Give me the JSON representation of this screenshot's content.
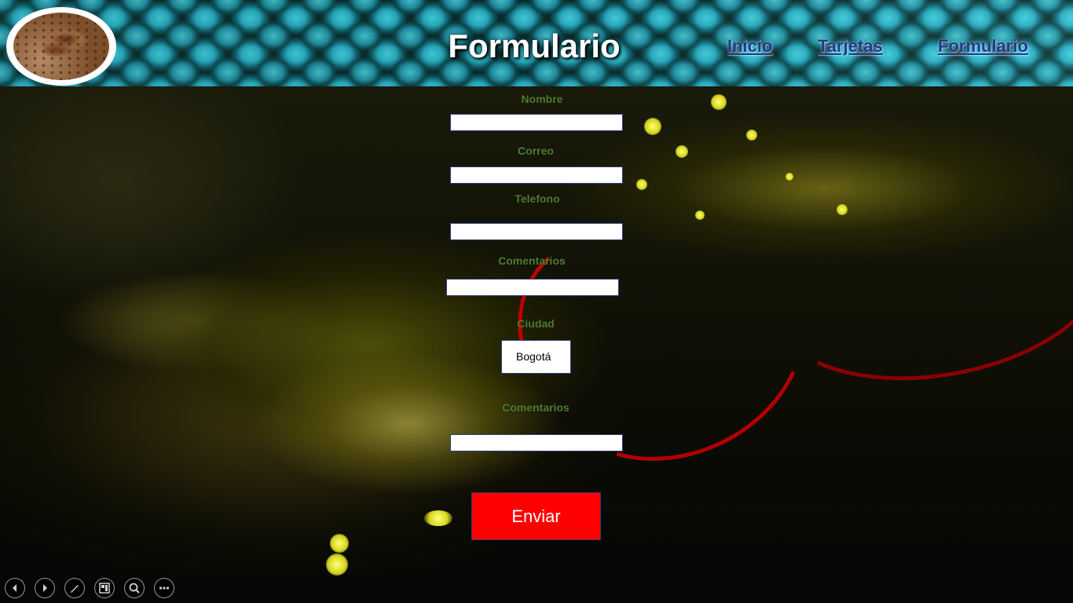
{
  "header": {
    "title": "Formulario",
    "nav": [
      {
        "label": "Inicio"
      },
      {
        "label": "Tarjetas"
      },
      {
        "label": "Formulario"
      }
    ],
    "logo_icon": "snake-photo-logo"
  },
  "form": {
    "fields": [
      {
        "label": "Nombre",
        "value": ""
      },
      {
        "label": "Correo",
        "value": ""
      },
      {
        "label": "Telefono",
        "value": ""
      },
      {
        "label": "Comentarios",
        "value": ""
      }
    ],
    "city": {
      "label": "Ciudad",
      "selected": "Bogotá"
    },
    "comments2": {
      "label": "Comentarios",
      "value": ""
    },
    "submit_label": "Enviar"
  },
  "toolbar": {
    "buttons": [
      "previous-slide-icon",
      "next-slide-icon",
      "pen-icon",
      "slides-grid-icon",
      "zoom-icon",
      "more-options-icon"
    ]
  },
  "colors": {
    "label": "#4e7d32",
    "submit": "#fe0000",
    "nav_link": "#1c3c8f",
    "input_border": "#2e3d7a"
  }
}
